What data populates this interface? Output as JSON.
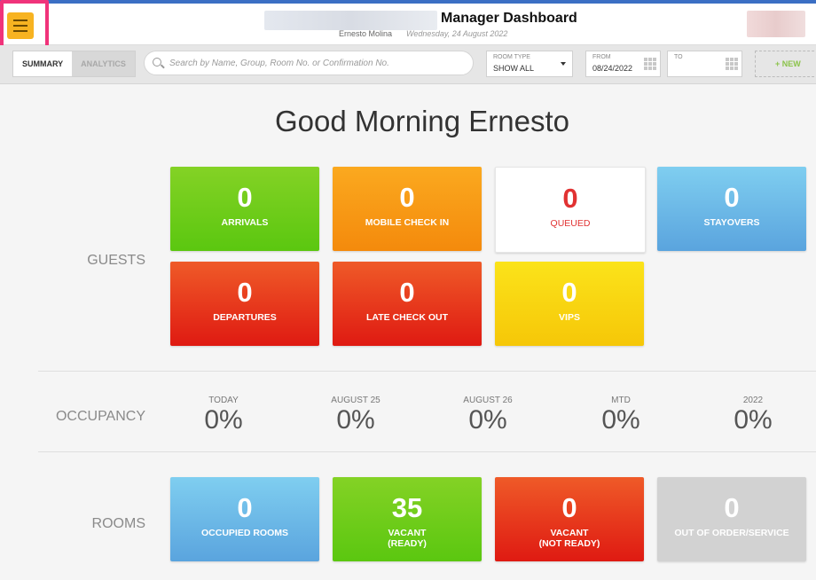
{
  "header": {
    "title": "Manager Dashboard",
    "user_name": "Ernesto Molina",
    "date": "Wednesday, 24 August 2022"
  },
  "toolbar": {
    "tabs": [
      {
        "label": "SUMMARY",
        "active": true
      },
      {
        "label": "ANALYTICS",
        "active": false
      }
    ],
    "search_placeholder": "Search by Name, Group, Room No. or Confirmation No.",
    "room_type": {
      "label": "ROOM TYPE",
      "value": "SHOW ALL"
    },
    "from": {
      "label": "FROM",
      "value": "08/24/2022"
    },
    "to": {
      "label": "TO",
      "value": ""
    },
    "new_label": "+ NEW"
  },
  "greeting": "Good Morning Ernesto",
  "guests": {
    "label": "GUESTS",
    "tiles": [
      {
        "value": "0",
        "label": "ARRIVALS",
        "color": "#6ccd1a"
      },
      {
        "value": "0",
        "label": "MOBILE CHECK IN",
        "color": "#f79a14"
      },
      {
        "value": "0",
        "label": "QUEUED",
        "color": "#ffffff"
      },
      {
        "value": "0",
        "label": "STAYOVERS",
        "color": "#6bb8e6"
      },
      {
        "value": "0",
        "label": "DEPARTURES",
        "color": "#e8391c"
      },
      {
        "value": "0",
        "label": "LATE CHECK OUT",
        "color": "#e8391c"
      },
      {
        "value": "0",
        "label": "VIPS",
        "color": "#f9d512"
      }
    ]
  },
  "occupancy": {
    "label": "OCCUPANCY",
    "items": [
      {
        "caption": "TODAY",
        "value": "0%"
      },
      {
        "caption": "AUGUST 25",
        "value": "0%"
      },
      {
        "caption": "AUGUST 26",
        "value": "0%"
      },
      {
        "caption": "MTD",
        "value": "0%"
      },
      {
        "caption": "2022",
        "value": "0%"
      }
    ]
  },
  "rooms": {
    "label": "ROOMS",
    "tiles": [
      {
        "value": "0",
        "label": "OCCUPIED ROOMS",
        "color": "#6bb8e6"
      },
      {
        "value": "35",
        "label": "VACANT",
        "sub": "(READY)",
        "color": "#6ccd1a"
      },
      {
        "value": "0",
        "label": "VACANT",
        "sub": "(NOT READY)",
        "color": "#e8391c"
      },
      {
        "value": "0",
        "label": "OUT OF ORDER/SERVICE",
        "color": "#d2d2d2"
      }
    ]
  }
}
